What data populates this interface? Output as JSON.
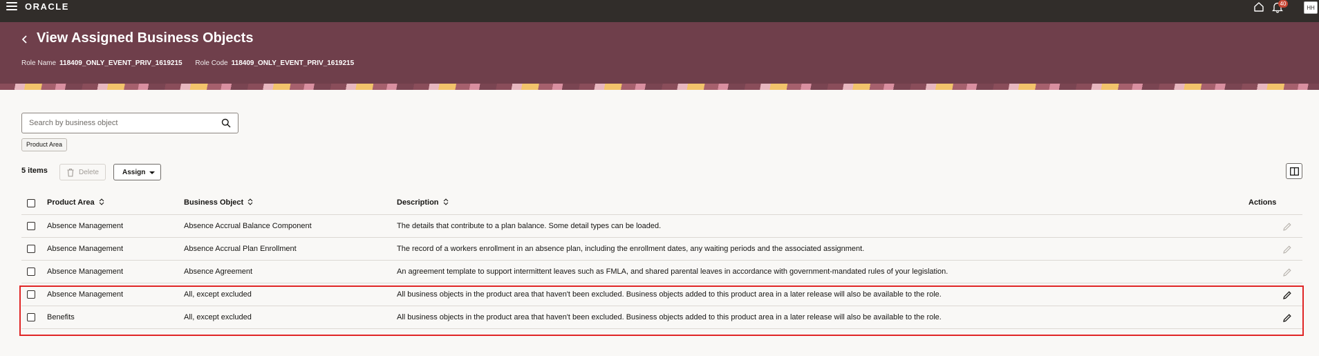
{
  "topbar": {
    "logo": "ORACLE",
    "notifications_count": "40",
    "avatar_initials": "HH"
  },
  "header": {
    "title": "View Assigned Business Objects",
    "role_name_label": "Role Name",
    "role_name_value": "118409_ONLY_EVENT_PRIV_1619215",
    "role_code_label": "Role Code",
    "role_code_value": "118409_ONLY_EVENT_PRIV_1619215"
  },
  "search": {
    "placeholder": "Search by business object",
    "filter_chip": "Product Area"
  },
  "toolbar": {
    "count": "5 items",
    "delete_label": "Delete",
    "assign_label": "Assign"
  },
  "table": {
    "columns": {
      "product_area": "Product Area",
      "business_object": "Business Object",
      "description": "Description",
      "actions": "Actions"
    },
    "rows": [
      {
        "product_area": "Absence Management",
        "business_object": "Absence Accrual Balance Component",
        "description": "The details that contribute to a plan balance. Some detail types can be loaded.",
        "editable": false
      },
      {
        "product_area": "Absence Management",
        "business_object": "Absence Accrual Plan Enrollment",
        "description": "The record of a workers enrollment in an absence plan, including the enrollment dates, any waiting periods and the associated assignment.",
        "editable": false
      },
      {
        "product_area": "Absence Management",
        "business_object": "Absence Agreement",
        "description": "An agreement template to support intermittent leaves such as FMLA, and shared parental leaves in accordance with government-mandated rules of your legislation.",
        "editable": false
      },
      {
        "product_area": "Absence Management",
        "business_object": "All, except excluded",
        "description": "All business objects in the product area that haven't been excluded. Business objects added to this product area in a later release will also be available to the role.",
        "editable": true
      },
      {
        "product_area": "Benefits",
        "business_object": "All, except excluded",
        "description": "All business objects in the product area that haven't been excluded. Business objects added to this product area in a later release will also be available to the role.",
        "editable": true
      }
    ]
  },
  "colors": {
    "topbar": "#312d2a",
    "header": "#6f3f4b",
    "highlight": "#e02525"
  }
}
